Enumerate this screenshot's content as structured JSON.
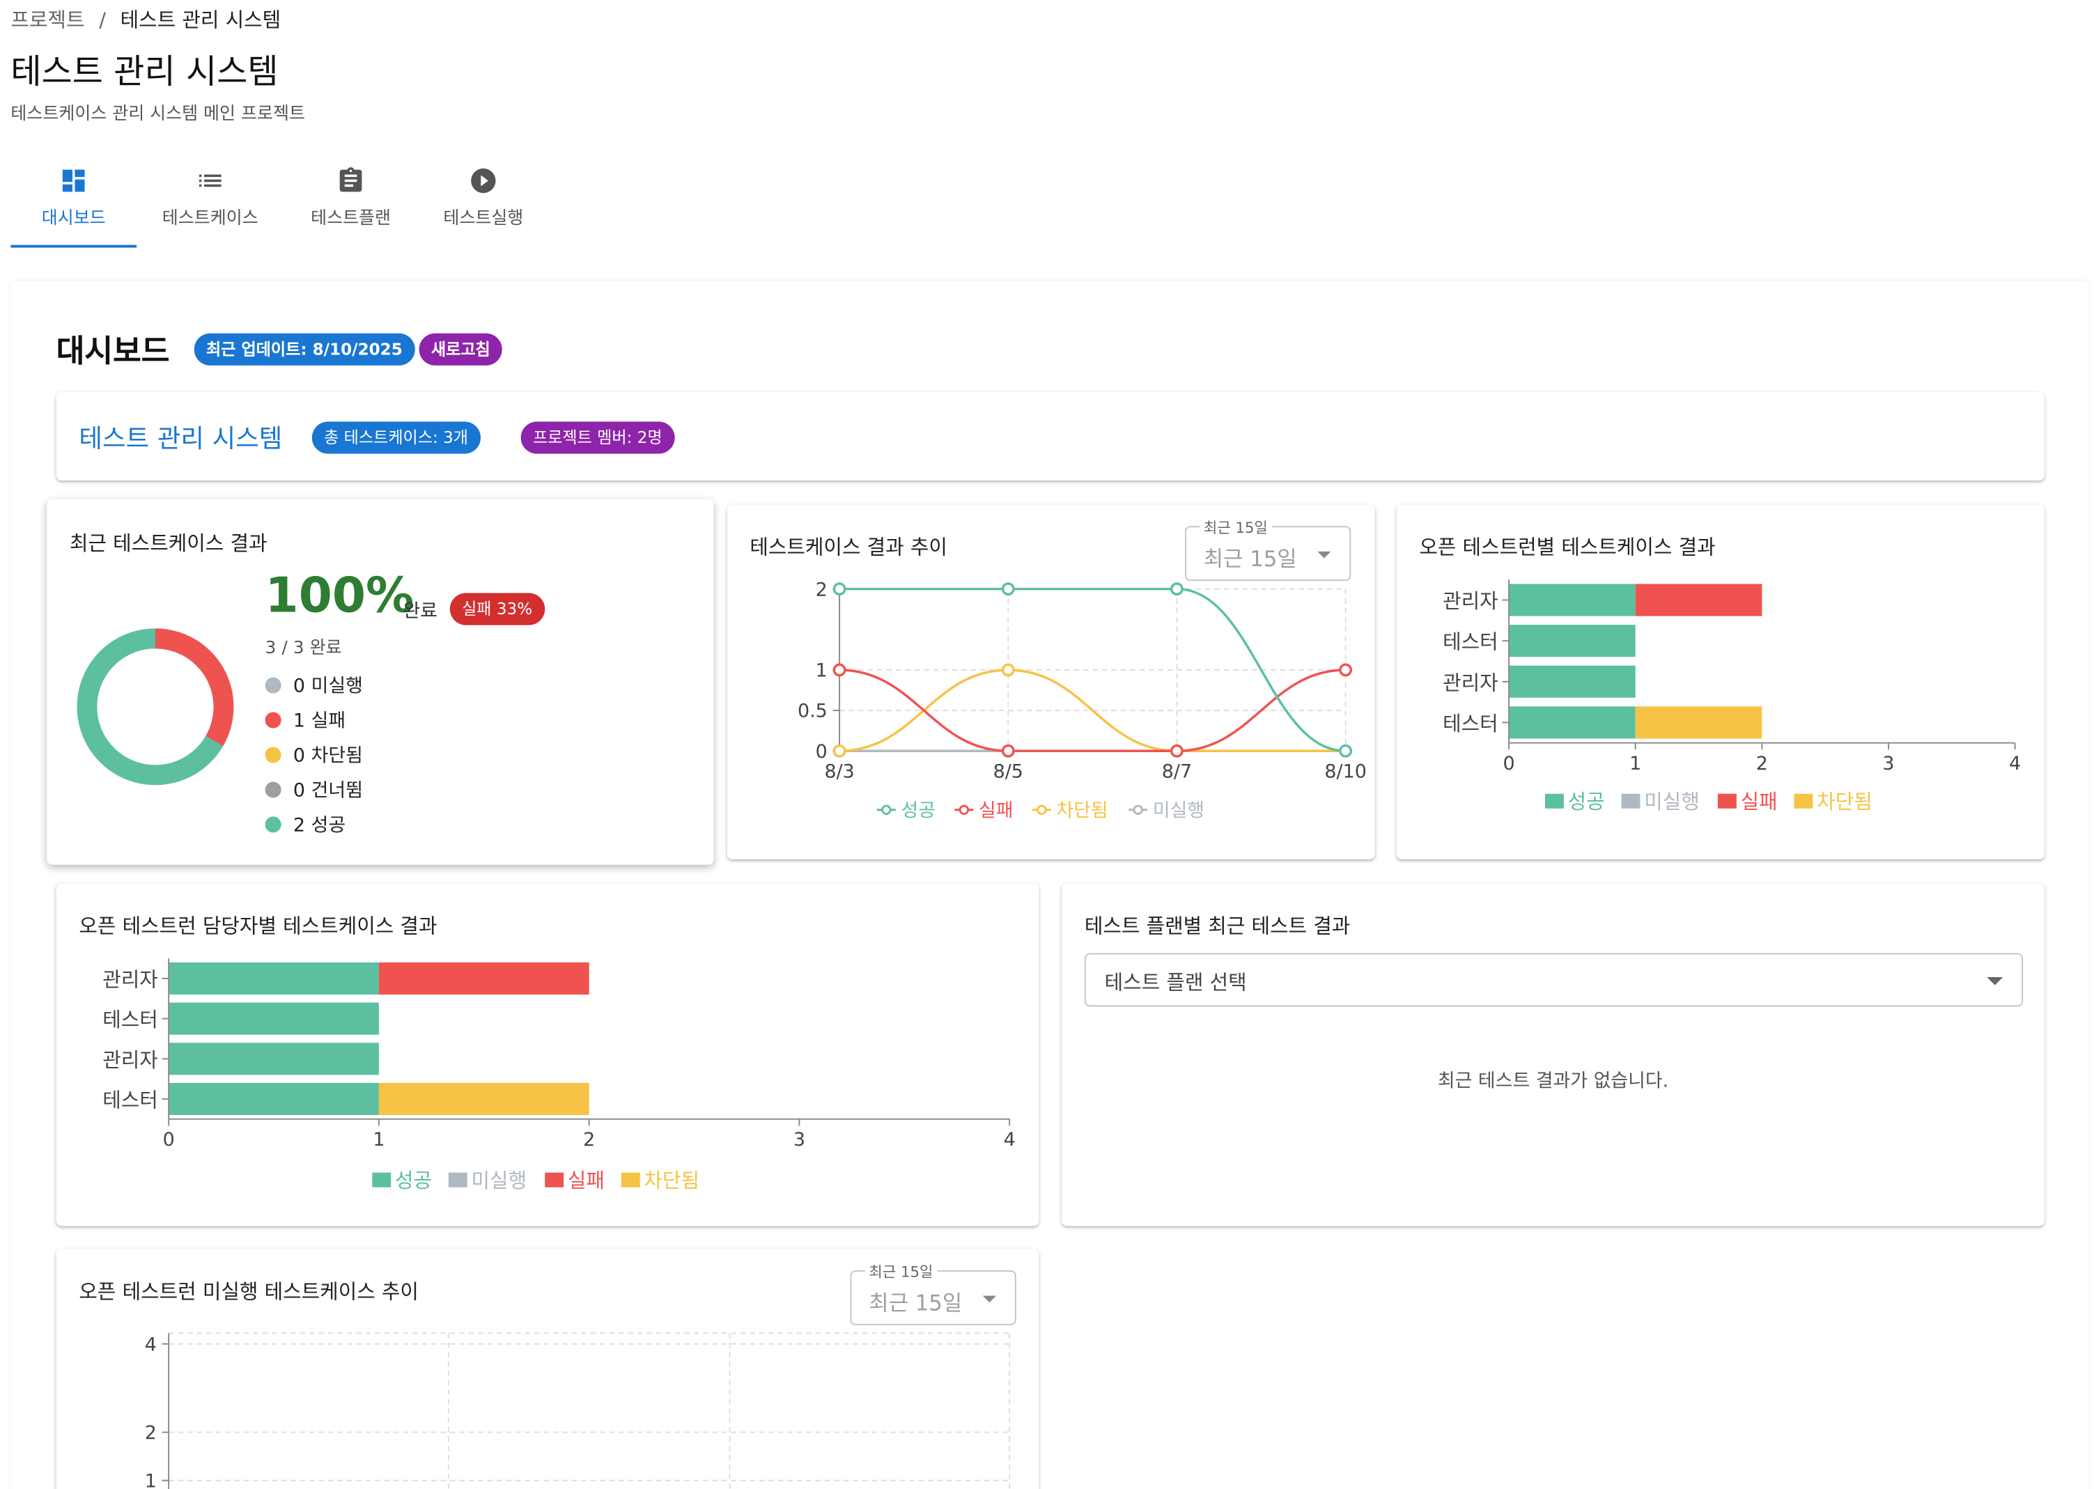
{
  "breadcrumb": {
    "parent": "프로젝트",
    "separator": "/",
    "current": "테스트 관리 시스템"
  },
  "page": {
    "title": "테스트 관리 시스템",
    "subtitle": "테스트케이스 관리 시스템 메인 프로젝트"
  },
  "tabs": [
    {
      "label": "대시보드",
      "icon": "dashboard-icon",
      "active": true
    },
    {
      "label": "테스트케이스",
      "icon": "list-icon",
      "active": false
    },
    {
      "label": "테스트플랜",
      "icon": "clipboard-icon",
      "active": false
    },
    {
      "label": "테스트실행",
      "icon": "play-circle-icon",
      "active": false
    }
  ],
  "dashboard": {
    "heading": "대시보드",
    "updated_chip": "최근 업데이트: 8/10/2025",
    "refresh_chip": "새로고침"
  },
  "project": {
    "name": "테스트 관리 시스템",
    "testcase_chip": "총 테스트케이스: 3개",
    "member_chip": "프로젝트 멤버: 2명"
  },
  "recent_results": {
    "title": "최근 테스트케이스 결과",
    "percent": "100%",
    "complete_label": "완료",
    "fail_chip": "실패 33%",
    "done_text": "3 / 3 완료",
    "legend": [
      {
        "text": "0 미실행",
        "color": "#b0b8c1"
      },
      {
        "text": "1 실패",
        "color": "#ef5350"
      },
      {
        "text": "0 차단됨",
        "color": "#f6c344"
      },
      {
        "text": "0 건너뜀",
        "color": "#9e9e9e"
      },
      {
        "text": "2 성공",
        "color": "#5cc0a0"
      }
    ]
  },
  "range_select": {
    "label": "최근 15일",
    "value": "최근 15일"
  },
  "trend_chart": {
    "title": "테스트케이스 결과 추이",
    "chart_data": {
      "type": "line",
      "x": [
        "8/3",
        "8/5",
        "8/7",
        "8/10"
      ],
      "yticks": [
        0,
        0.5,
        1,
        2
      ],
      "series": [
        {
          "name": "성공",
          "color": "#5cc0a0",
          "values": [
            2,
            2,
            2,
            0
          ]
        },
        {
          "name": "실패",
          "color": "#ef5350",
          "values": [
            1,
            0,
            0,
            1
          ]
        },
        {
          "name": "차단됨",
          "color": "#f6c344",
          "values": [
            0,
            1,
            0,
            0
          ]
        },
        {
          "name": "미실행",
          "color": "#b0b8c1",
          "values": [
            0,
            0,
            0,
            0
          ]
        }
      ]
    }
  },
  "run_chart": {
    "title": "오픈 테스트런별 테스트케이스 결과",
    "chart_data": {
      "type": "bar",
      "orientation": "horizontal",
      "stacked": true,
      "categories": [
        "관리자",
        "테스터",
        "관리자",
        "테스터"
      ],
      "xlim": [
        0,
        4
      ],
      "xticks": [
        0,
        1,
        2,
        3,
        4
      ],
      "series": [
        {
          "name": "성공",
          "color": "#5cc0a0",
          "values": [
            1,
            1,
            1,
            1
          ]
        },
        {
          "name": "미실행",
          "color": "#b0b8c1",
          "values": [
            0,
            0,
            0,
            0
          ]
        },
        {
          "name": "실패",
          "color": "#ef5350",
          "values": [
            1,
            0,
            0,
            0
          ]
        },
        {
          "name": "차단됨",
          "color": "#f6c344",
          "values": [
            0,
            0,
            0,
            1
          ]
        }
      ]
    }
  },
  "assignee_chart": {
    "title": "오픈 테스트런 담당자별 테스트케이스 결과",
    "chart_data": {
      "type": "bar",
      "orientation": "horizontal",
      "stacked": true,
      "categories": [
        "관리자",
        "테스터",
        "관리자",
        "테스터"
      ],
      "xlim": [
        0,
        4
      ],
      "xticks": [
        0,
        1,
        2,
        3,
        4
      ],
      "series": [
        {
          "name": "성공",
          "color": "#5cc0a0",
          "values": [
            1,
            1,
            1,
            1
          ]
        },
        {
          "name": "미실행",
          "color": "#b0b8c1",
          "values": [
            0,
            0,
            0,
            0
          ]
        },
        {
          "name": "실패",
          "color": "#ef5350",
          "values": [
            1,
            0,
            0,
            0
          ]
        },
        {
          "name": "차단됨",
          "color": "#f6c344",
          "values": [
            0,
            0,
            0,
            1
          ]
        }
      ]
    }
  },
  "plan_results": {
    "title": "테스트 플랜별 최근 테스트 결과",
    "select_placeholder": "테스트 플랜 선택",
    "empty_message": "최근 테스트 결과가 없습니다."
  },
  "unexecuted_chart": {
    "title": "오픈 테스트런 미실행 테스트케이스 추이",
    "chart_data": {
      "type": "line",
      "yticks": [
        1,
        2,
        4
      ],
      "series": []
    }
  },
  "colors": {
    "accent": "#1976d2",
    "success": "#5cc0a0",
    "fail": "#ef5350",
    "blocked": "#f6c344",
    "untested": "#b0b8c1",
    "skipped": "#9e9e9e"
  }
}
